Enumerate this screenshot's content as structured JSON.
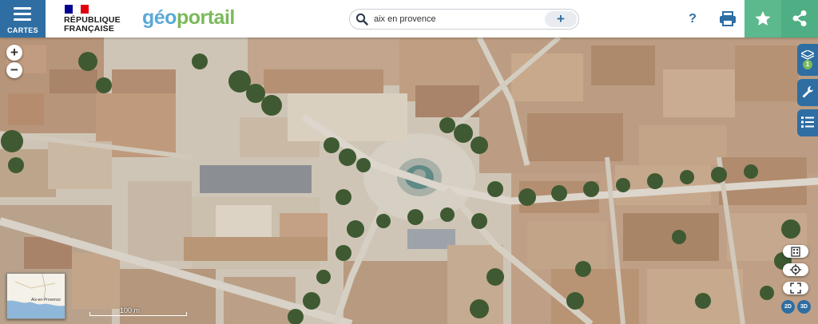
{
  "header": {
    "menu": {
      "label": "CARTES",
      "icon": "hamburger-icon"
    },
    "republic_logo": {
      "line1": "RÉPUBLIQUE",
      "line2": "FRANÇAISE",
      "flag_colors": [
        "#000091",
        "#ffffff",
        "#e1000f"
      ]
    },
    "brand": {
      "part1": "géo",
      "part2": "portail"
    },
    "search": {
      "value": "aix en provence",
      "icon": "search-icon",
      "add_label": "+"
    },
    "help": {
      "label": "?",
      "icon": "help-icon"
    },
    "print": {
      "icon": "printer-icon"
    },
    "favorite": {
      "icon": "star-icon"
    },
    "share": {
      "icon": "share-icon"
    }
  },
  "map": {
    "zoom_in_label": "+",
    "zoom_out_label": "−",
    "side_tabs": [
      {
        "icon": "layers-icon",
        "badge": "1"
      },
      {
        "icon": "wrench-icon"
      },
      {
        "icon": "list-icon"
      }
    ],
    "tools": [
      {
        "icon": "building-icon"
      },
      {
        "icon": "geolocate-icon"
      },
      {
        "icon": "fullscreen-icon"
      }
    ],
    "view_modes": [
      "2D",
      "3D"
    ],
    "overview": {
      "place": "Aix-en-Provence"
    },
    "scale": {
      "label": "100 m"
    }
  },
  "colors": {
    "primary_blue": "#2e6ea3",
    "accent_green": "#5cb88d",
    "brand_blue": "#5aa9d6",
    "brand_green": "#7bb95b"
  }
}
